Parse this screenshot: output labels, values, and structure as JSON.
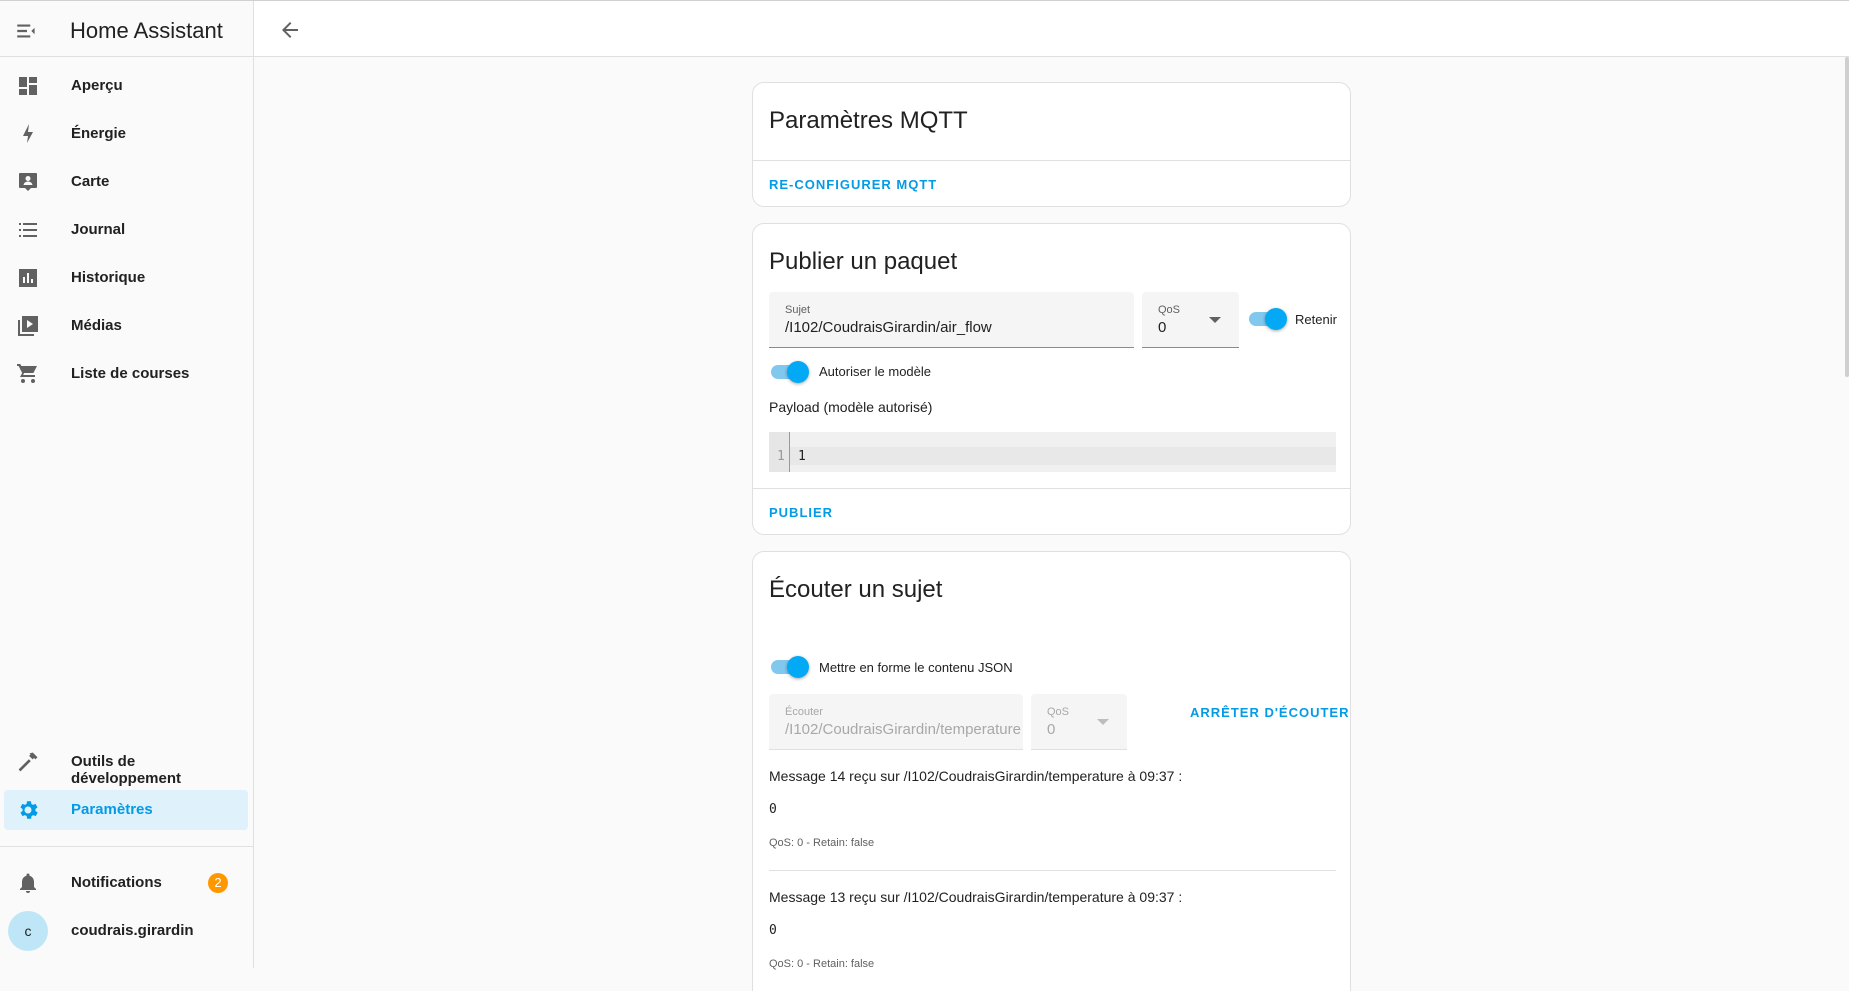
{
  "app": {
    "title": "Home Assistant"
  },
  "sidebar": {
    "items": [
      {
        "label": "Aperçu",
        "icon": "dashboard-icon"
      },
      {
        "label": "Énergie",
        "icon": "lightning-icon"
      },
      {
        "label": "Carte",
        "icon": "map-account-icon"
      },
      {
        "label": "Journal",
        "icon": "list-icon"
      },
      {
        "label": "Historique",
        "icon": "chart-bar-icon"
      },
      {
        "label": "Médias",
        "icon": "play-box-icon"
      },
      {
        "label": "Liste de courses",
        "icon": "cart-icon"
      }
    ],
    "dev_tools": {
      "label": "Outils de développement",
      "icon": "hammer-icon"
    },
    "settings": {
      "label": "Paramètres",
      "icon": "gear-icon"
    },
    "notifications": {
      "label": "Notifications",
      "count": "2",
      "icon": "bell-icon"
    },
    "user": {
      "name": "coudrais.girardin",
      "initial": "c"
    }
  },
  "accent_color": "#039be5",
  "mqtt_settings": {
    "title": "Paramètres MQTT",
    "reconfigure_label": "RE-CONFIGURER MQTT"
  },
  "publish": {
    "title": "Publier un paquet",
    "topic_label": "Sujet",
    "topic_value": "/I102/CoudraisGirardin/air_flow",
    "qos_label": "QoS",
    "qos_value": "0",
    "retain_label": "Retenir",
    "retain_on": true,
    "template_label": "Autoriser le modèle",
    "template_on": true,
    "payload_label": "Payload (modèle autorisé)",
    "payload_line_number": "1",
    "payload_value": "1",
    "publish_label": "PUBLIER"
  },
  "listen": {
    "title": "Écouter un sujet",
    "format_json_label": "Mettre en forme le contenu JSON",
    "format_json_on": true,
    "listen_label": "Écouter",
    "listen_value": "/I102/CoudraisGirardin/temperature",
    "qos_label": "QoS",
    "qos_value": "0",
    "stop_label": "ARRÊTER D'ÉCOUTER",
    "messages": [
      {
        "title": "Message 14 reçu sur /I102/CoudraisGirardin/temperature à 09:37 :",
        "payload": "0",
        "meta": "QoS: 0 - Retain: false"
      },
      {
        "title": "Message 13 reçu sur /I102/CoudraisGirardin/temperature à 09:37 :",
        "payload": "0",
        "meta": "QoS: 0 - Retain: false"
      }
    ]
  }
}
